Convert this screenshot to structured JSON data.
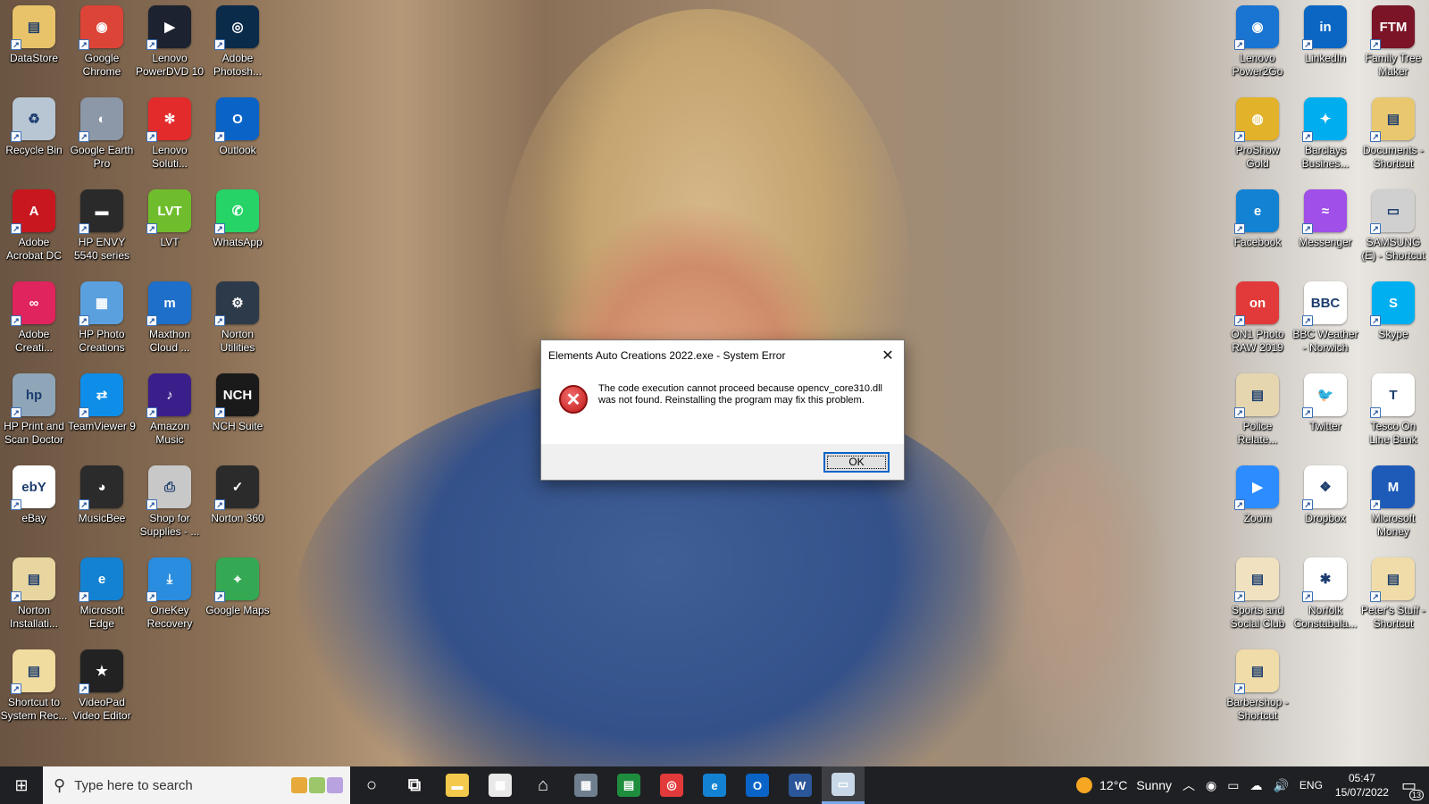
{
  "desktop": {
    "left_icons": [
      {
        "label": "DataStore",
        "icon": "folder-icon",
        "color": "#e8c36a",
        "glyph": "▤"
      },
      {
        "label": "Google\nChrome",
        "icon": "chrome-icon",
        "color": "#db4437",
        "glyph": "◉"
      },
      {
        "label": "Lenovo\nPowerDVD 10",
        "icon": "powerdvd-icon",
        "color": "#1c2230",
        "glyph": "▶"
      },
      {
        "label": "Adobe\nPhotosh...",
        "icon": "photoshop-icon",
        "color": "#0b2b4a",
        "glyph": "◎"
      },
      {
        "label": "Recycle Bin",
        "icon": "recycle-bin-icon",
        "color": "#b8c6d4",
        "glyph": "♻"
      },
      {
        "label": "Google Earth\nPro",
        "icon": "google-earth-icon",
        "color": "#8c98a8",
        "glyph": "◐"
      },
      {
        "label": "Lenovo\nSoluti...",
        "icon": "lenovo-solutions-icon",
        "color": "#e42b2b",
        "glyph": "✻"
      },
      {
        "label": "Outlook",
        "icon": "outlook-icon",
        "color": "#0a64c8",
        "glyph": "O"
      },
      {
        "label": "Adobe\nAcrobat DC",
        "icon": "acrobat-icon",
        "color": "#c8171e",
        "glyph": "A"
      },
      {
        "label": "HP ENVY\n5540 series",
        "icon": "printer-icon",
        "color": "#2a2a2a",
        "glyph": "▬"
      },
      {
        "label": "LVT",
        "icon": "lvt-icon",
        "color": "#6fbd2d",
        "glyph": "LVT"
      },
      {
        "label": "WhatsApp",
        "icon": "whatsapp-icon",
        "color": "#25d366",
        "glyph": "✆"
      },
      {
        "label": "Adobe\nCreati...",
        "icon": "creative-cloud-icon",
        "color": "#e0245e",
        "glyph": "∞"
      },
      {
        "label": "HP Photo\nCreations",
        "icon": "hp-photo-icon",
        "color": "#5aa0de",
        "glyph": "▦"
      },
      {
        "label": "Maxthon\nCloud ...",
        "icon": "maxthon-icon",
        "color": "#1d6fc9",
        "glyph": "m"
      },
      {
        "label": "Norton\nUtilities",
        "icon": "norton-utilities-icon",
        "color": "#2d3a4a",
        "glyph": "⚙"
      },
      {
        "label": "HP Print and\nScan Doctor",
        "icon": "hp-doctor-icon",
        "color": "#8fa6b8",
        "glyph": "hp"
      },
      {
        "label": "TeamViewer 9",
        "icon": "teamviewer-icon",
        "color": "#0e8ee9",
        "glyph": "⇄"
      },
      {
        "label": "Amazon\nMusic",
        "icon": "amazon-music-icon",
        "color": "#3a1f8a",
        "glyph": "♪"
      },
      {
        "label": "NCH Suite",
        "icon": "nch-icon",
        "color": "#1a1a1a",
        "glyph": "NCH"
      },
      {
        "label": "eBay",
        "icon": "ebay-icon",
        "color": "#ffffff",
        "glyph": "ebY"
      },
      {
        "label": "MusicBee",
        "icon": "musicbee-icon",
        "color": "#2b2b2b",
        "glyph": "◕"
      },
      {
        "label": "Shop for\nSupplies - ...",
        "icon": "shop-supplies-icon",
        "color": "#c8c8c8",
        "glyph": "⎙"
      },
      {
        "label": "Norton 360",
        "icon": "norton-360-icon",
        "color": "#2b2b2b",
        "glyph": "✓"
      },
      {
        "label": "Norton\nInstallati...",
        "icon": "norton-install-icon",
        "color": "#e8d6a0",
        "glyph": "▤"
      },
      {
        "label": "Microsoft\nEdge",
        "icon": "edge-icon",
        "color": "#1482d2",
        "glyph": "e"
      },
      {
        "label": "OneKey\nRecovery",
        "icon": "onekey-icon",
        "color": "#2a8de0",
        "glyph": "⤓"
      },
      {
        "label": "Google Maps",
        "icon": "google-maps-icon",
        "color": "#34a853",
        "glyph": "⌖"
      },
      {
        "label": "Shortcut to\nSystem Rec...",
        "icon": "shortcut-folder-icon",
        "color": "#f1dca0",
        "glyph": "▤"
      },
      {
        "label": "VideoPad\nVideo Editor",
        "icon": "videopad-icon",
        "color": "#222222",
        "glyph": "★"
      }
    ],
    "right_icons": [
      {
        "label": "Lenovo\nPower2Go",
        "icon": "power2go-icon",
        "color": "#1a74d1",
        "glyph": "◉"
      },
      {
        "label": "LinkedIn",
        "icon": "linkedin-icon",
        "color": "#0a66c2",
        "glyph": "in"
      },
      {
        "label": "Family Tree\nMaker",
        "icon": "family-tree-icon",
        "color": "#7a1426",
        "glyph": "FTM"
      },
      {
        "label": "ProShow\nGold",
        "icon": "proshow-icon",
        "color": "#e2b22a",
        "glyph": "◍"
      },
      {
        "label": "Barclays\nBusines...",
        "icon": "barclays-icon",
        "color": "#00aeef",
        "glyph": "✦"
      },
      {
        "label": "Documents -\nShortcut",
        "icon": "documents-folder-icon",
        "color": "#e9c76e",
        "glyph": "▤"
      },
      {
        "label": "Facebook",
        "icon": "facebook-edge-icon",
        "color": "#1482d2",
        "glyph": "e"
      },
      {
        "label": "Messenger",
        "icon": "messenger-icon",
        "color": "#a04fe8",
        "glyph": "≈"
      },
      {
        "label": "SAMSUNG\n(E) - Shortcut",
        "icon": "drive-icon",
        "color": "#d0d0d0",
        "glyph": "▭"
      },
      {
        "label": "ON1 Photo\nRAW 2019",
        "icon": "on1-icon",
        "color": "#e23a3a",
        "glyph": "on"
      },
      {
        "label": "BBC Weather\n- Norwich",
        "icon": "bbc-icon",
        "color": "#ffffff",
        "glyph": "BBC"
      },
      {
        "label": "Skype",
        "icon": "skype-icon",
        "color": "#00aff0",
        "glyph": "S"
      },
      {
        "label": "Police\nRelate...",
        "icon": "police-doc-icon",
        "color": "#e6d6b0",
        "glyph": "▤"
      },
      {
        "label": "Twitter",
        "icon": "twitter-doc-icon",
        "color": "#ffffff",
        "glyph": "🐦"
      },
      {
        "label": "Tesco On\nLine Bank",
        "icon": "tesco-doc-icon",
        "color": "#ffffff",
        "glyph": "T"
      },
      {
        "label": "Zoom",
        "icon": "zoom-icon",
        "color": "#2d8cff",
        "glyph": "▶"
      },
      {
        "label": "Dropbox",
        "icon": "dropbox-icon",
        "color": "#ffffff",
        "glyph": "❖"
      },
      {
        "label": "Microsoft\nMoney",
        "icon": "ms-money-icon",
        "color": "#1e5bb8",
        "glyph": "M"
      },
      {
        "label": "Sports and\nSocial Club",
        "icon": "sports-doc-icon",
        "color": "#f0e2c0",
        "glyph": "▤"
      },
      {
        "label": "Norfolk\nConstabula...",
        "icon": "norfolk-doc-icon",
        "color": "#ffffff",
        "glyph": "✱"
      },
      {
        "label": "Peter's Stuff -\nShortcut",
        "icon": "peters-folder-icon",
        "color": "#f0dca8",
        "glyph": "▤"
      },
      {
        "label": "Barbershop -\nShortcut",
        "icon": "barbershop-folder-icon",
        "color": "#f0dca8",
        "glyph": "▤"
      }
    ]
  },
  "dialog": {
    "title": "Elements Auto Creations 2022.exe - System Error",
    "message": "The code execution cannot proceed because opencv_core310.dll was not found. Reinstalling the program may fix this problem.",
    "ok_label": "OK",
    "close_glyph": "✕",
    "error_glyph": "✕"
  },
  "taskbar": {
    "search_placeholder": "Type here to search",
    "pinned": [
      {
        "name": "cortana-icon",
        "glyph": "○",
        "color": "transparent"
      },
      {
        "name": "task-view-icon",
        "glyph": "⧉",
        "color": "transparent"
      },
      {
        "name": "file-explorer-icon",
        "glyph": "▬",
        "color": "#f2c94c"
      },
      {
        "name": "microsoft-store-icon",
        "glyph": "▦",
        "color": "#e8e8e8"
      },
      {
        "name": "home-icon",
        "glyph": "⌂",
        "color": "transparent"
      },
      {
        "name": "calculator-icon",
        "glyph": "▦",
        "color": "#6f7f8f"
      },
      {
        "name": "sheets-icon",
        "glyph": "▤",
        "color": "#1e8e3e"
      },
      {
        "name": "on1-taskbar-icon",
        "glyph": "◎",
        "color": "#e23a3a"
      },
      {
        "name": "edge-taskbar-icon",
        "glyph": "e",
        "color": "#1482d2"
      },
      {
        "name": "outlook-taskbar-icon",
        "glyph": "O",
        "color": "#0a64c8"
      },
      {
        "name": "word-taskbar-icon",
        "glyph": "W",
        "color": "#2b579a"
      },
      {
        "name": "active-app-icon",
        "glyph": "▭",
        "color": "#c8d8e8"
      }
    ],
    "weather": {
      "temp": "12°C",
      "condition": "Sunny"
    },
    "language": "ENG",
    "time": "05:47",
    "date": "15/07/2022",
    "notification_count": "13"
  }
}
